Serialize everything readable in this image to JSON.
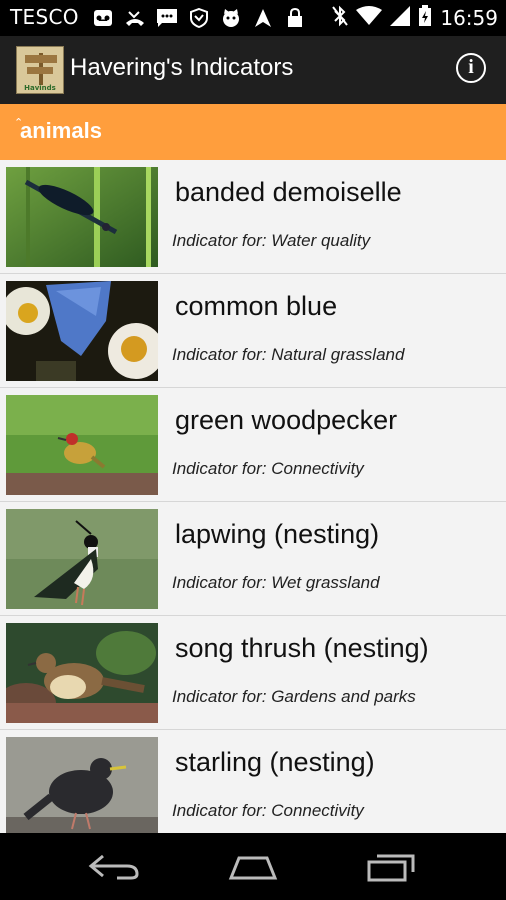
{
  "status_bar": {
    "carrier": "TESCO",
    "time": "16:59",
    "icons": [
      "voicemail-icon",
      "missed-call-icon",
      "sms-icon",
      "shield-icon",
      "cat-icon",
      "navigation-icon",
      "lock-icon",
      "bluetooth-off-icon",
      "wifi-icon",
      "signal-icon",
      "battery-icon"
    ]
  },
  "action_bar": {
    "title": "Havering's Indicators",
    "logo_text": "Havinds",
    "info_label": "i"
  },
  "category": {
    "label": "animals"
  },
  "items": [
    {
      "name": "banded demoiselle",
      "indicator": "Indicator for: Water quality"
    },
    {
      "name": "common blue",
      "indicator": "Indicator for: Natural grassland"
    },
    {
      "name": "green woodpecker",
      "indicator": "Indicator for: Connectivity"
    },
    {
      "name": "lapwing (nesting)",
      "indicator": "Indicator for: Wet grassland"
    },
    {
      "name": "song thrush (nesting)",
      "indicator": "Indicator for: Gardens and parks"
    },
    {
      "name": "starling (nesting)",
      "indicator": "Indicator for: Connectivity"
    }
  ],
  "colors": {
    "accent_orange": "#ff9e3d",
    "action_bar": "#1f1f1f",
    "list_bg": "#f3f3f3"
  },
  "nav_bar": {
    "icons": [
      "back-icon",
      "home-icon",
      "recents-icon"
    ]
  }
}
